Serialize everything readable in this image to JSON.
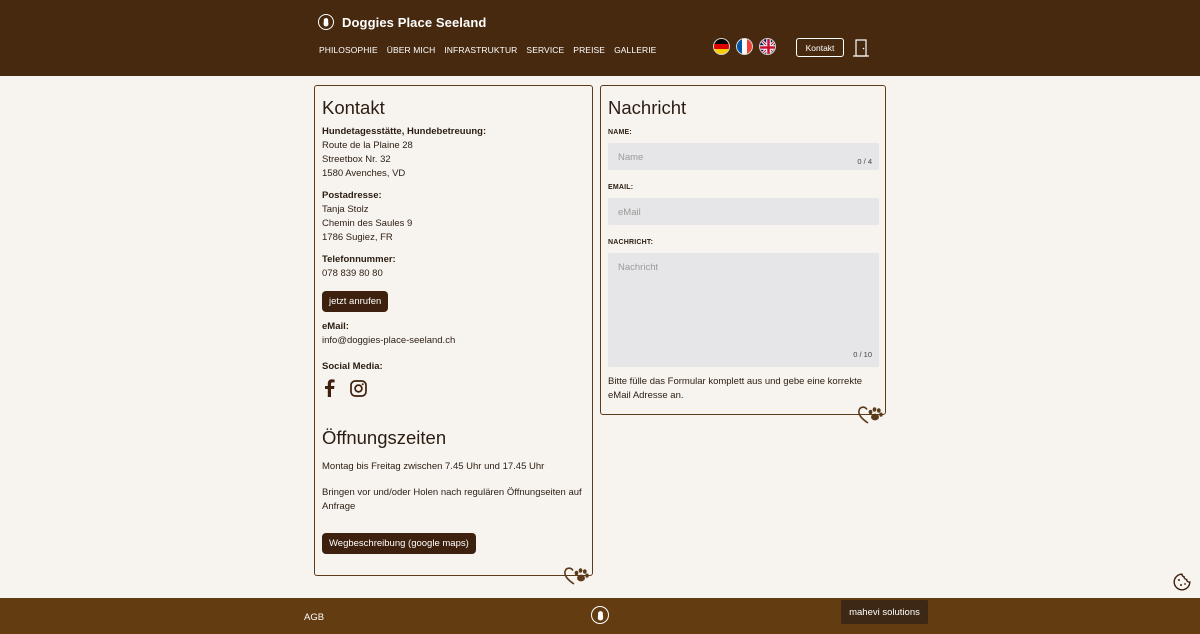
{
  "header": {
    "brand_title": "Doggies Place Seeland",
    "nav": [
      "PHILOSOPHIE",
      "ÜBER MICH",
      "INFRASTRUKTUR",
      "SERVICE",
      "PREISE",
      "GALLERIE"
    ],
    "contact_button": "Kontakt"
  },
  "contact": {
    "title": "Kontakt",
    "daycare_label": "Hundetagesstätte, Hundebetreuung:",
    "daycare_address": [
      "Route de la Plaine 28",
      "Streetbox Nr. 32",
      "1580 Avenches, VD"
    ],
    "postal_label": "Postadresse:",
    "postal_address": [
      "Tanja Stolz",
      "Chemin des Saules 9",
      "1786 Sugiez, FR"
    ],
    "phone_label": "Telefonnummer:",
    "phone": "078 839 80 80",
    "call_button": "jetzt anrufen",
    "email_label": "eMail:",
    "email": "info@doggies-place-seeland.ch",
    "social_label": "Social Media:"
  },
  "hours": {
    "title": "Öffnungszeiten",
    "line1": "Montag bis Freitag zwischen 7.45 Uhr und 17.45 Uhr",
    "line2": "Bringen vor und/oder Holen nach regulären Öffnungseiten auf Anfrage",
    "maps_button": "Wegbeschreibung (google maps)"
  },
  "form": {
    "title": "Nachricht",
    "name_label": "NAME:",
    "name_placeholder": "Name",
    "name_counter": "0 / 4",
    "email_label": "EMAIL:",
    "email_placeholder": "eMail",
    "message_label": "NACHRICHT:",
    "message_placeholder": "Nachricht",
    "message_counter": "0 / 10",
    "hint": "Bitte fülle das Formular komplett aus und gebe eine korrekte eMail Adresse an."
  },
  "footer": {
    "agb": "AGB",
    "credit": "mahevi solutions"
  },
  "colors": {
    "header_bg": "#47290f",
    "footer_bg": "#633c12",
    "button_bg": "#3d200d",
    "card_border": "#5c3b1c",
    "page_bg": "#f7f4ef"
  }
}
